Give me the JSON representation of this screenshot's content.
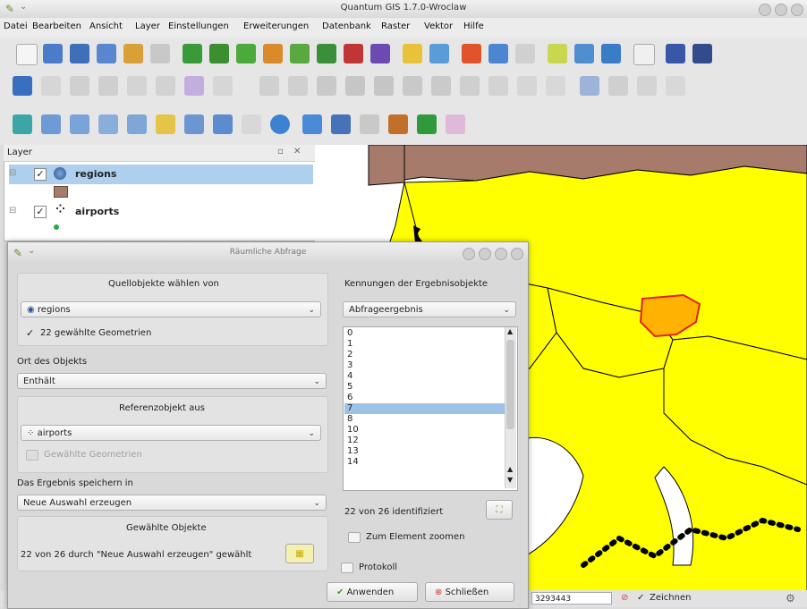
{
  "window": {
    "title": "Quantum GIS 1.7.0-Wroclaw"
  },
  "menu": [
    "Datei",
    "Bearbeiten",
    "Ansicht",
    "Layer",
    "Einstellungen",
    "Erweiterungen",
    "Datenbank",
    "Raster",
    "Vektor",
    "Hilfe"
  ],
  "layers_panel": {
    "title": "Layer",
    "layers": [
      {
        "name": "regions",
        "checked": true,
        "icon": "polygon-layer-icon"
      },
      {
        "name": "airports",
        "checked": true,
        "icon": "point-layer-icon"
      }
    ]
  },
  "dialog": {
    "title": "Räumliche Abfrage",
    "source_label": "Quellobjekte wählen von",
    "source_value": "regions",
    "selected_geometries": "22 gewählte Geometrien",
    "location_label": "Ort des Objekts",
    "location_value": "Enthält",
    "reference_label": "Referenzobjekt aus",
    "reference_value": "airports",
    "reference_checkbox": "Gewählte Geometrien",
    "save_label": "Das Ergebnis speichern in",
    "save_value": "Neue Auswahl erzeugen",
    "chosen_label": "Gewählte Objekte",
    "chosen_text": "22 von 26 durch \"Neue Auswahl erzeugen\" gewählt",
    "result_ids_label": "Kennungen der Ergebnisobjekte",
    "result_ids_value": "Abfrageergebnis",
    "ids": [
      "0",
      "1",
      "2",
      "3",
      "4",
      "5",
      "6",
      "7",
      "8",
      "10",
      "12",
      "13",
      "14"
    ],
    "selected_id": "7",
    "identified": "22 von 26 identifiziert",
    "zoom_checkbox": "Zum Element zoomen",
    "log_checkbox": "Protokoll",
    "apply_button": "Anwenden",
    "close_button": "Schließen"
  },
  "status": {
    "coord": "3293443",
    "render": "Zeichnen",
    "render_checked": true
  },
  "colors": {
    "region_fill": "#ffff00",
    "region_border": "#000000",
    "selected_fill": "#ffb300",
    "selected_border": "#e02020",
    "land_other": "#a67b6b",
    "water": "#ffffff"
  }
}
